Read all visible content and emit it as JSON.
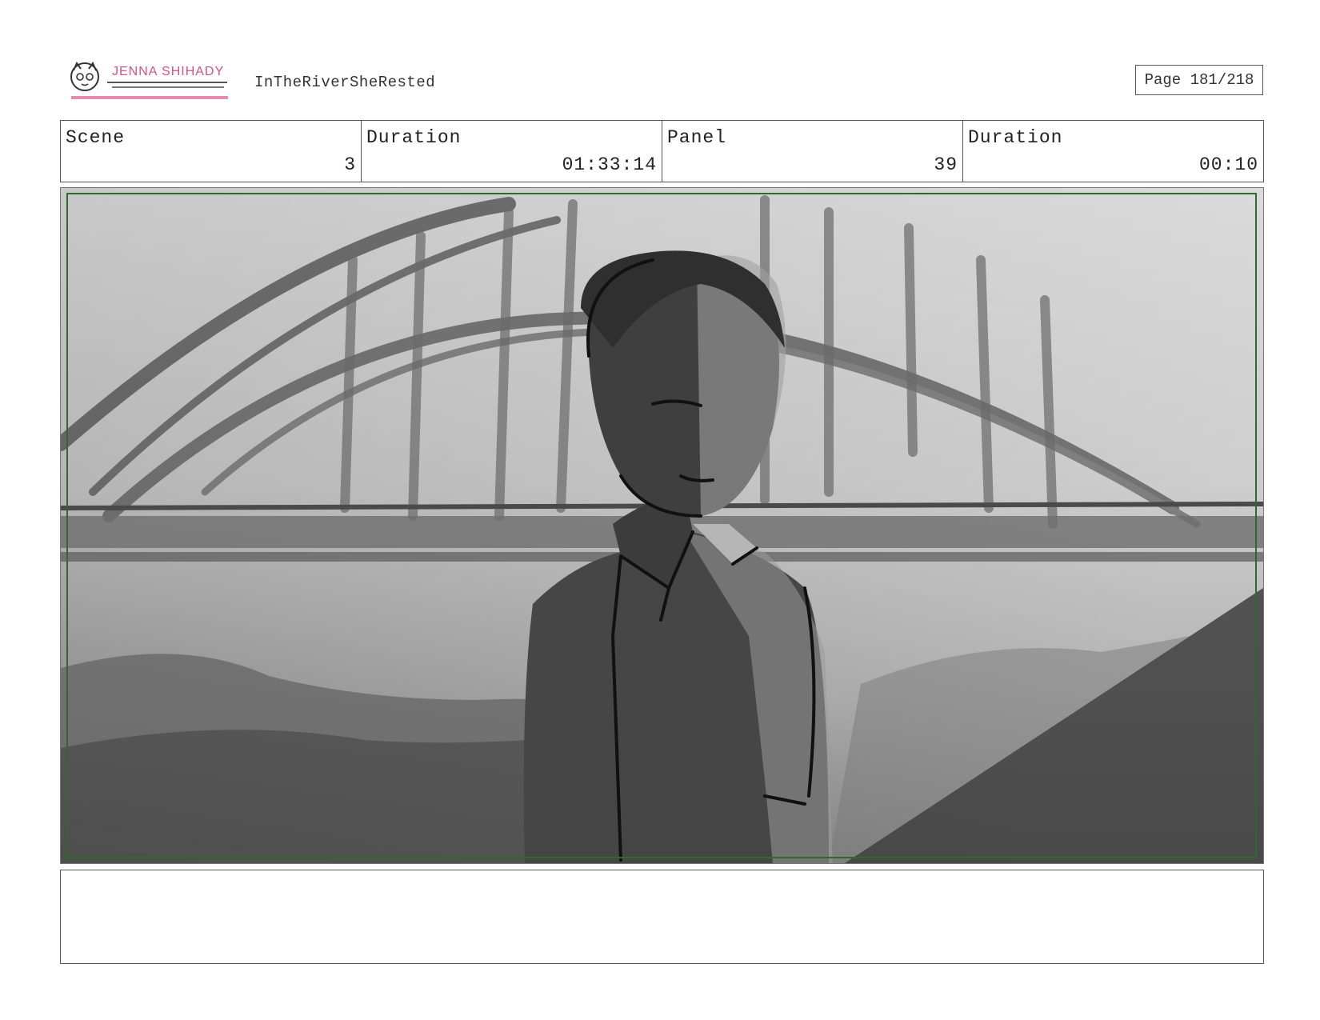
{
  "header": {
    "logo_text": "JENNA SHIHADY",
    "project_title": "InTheRiverSheRested",
    "page_label": "Page 181/218"
  },
  "info": {
    "scene_label": "Scene",
    "scene_value": "3",
    "scene_duration_label": "Duration",
    "scene_duration_value": "01:33:14",
    "panel_label": "Panel",
    "panel_value": "39",
    "panel_duration_label": "Duration",
    "panel_duration_value": "00:10"
  },
  "panel": {
    "safe_area_color": "#2d6b2d"
  },
  "notes": {
    "text": ""
  }
}
